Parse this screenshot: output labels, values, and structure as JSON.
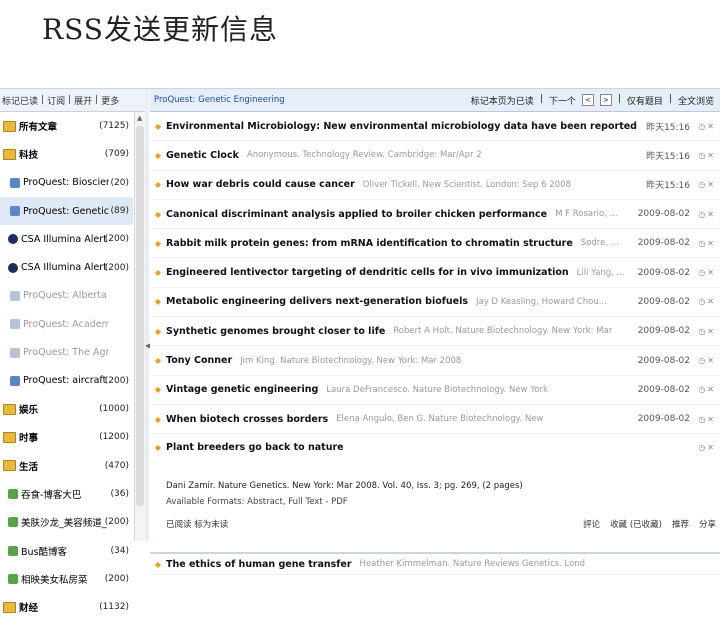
{
  "slide_title": "RSS发送更新信息",
  "left_toolbar": {
    "items": [
      "标记已读",
      "订阅",
      "展开",
      "更多"
    ]
  },
  "tree": [
    {
      "label": "所有文章",
      "count": "(7125)",
      "kind": "cat-root"
    },
    {
      "label": "科技",
      "count": "(709)",
      "kind": "cat"
    },
    {
      "label": "ProQuest: Bioscience...",
      "count": "(20)",
      "kind": "rss"
    },
    {
      "label": "ProQuest: Genetic En...",
      "count": "(89)",
      "kind": "rss",
      "selected": true
    },
    {
      "label": "CSA Illumina Alert: K...",
      "count": "(200)",
      "kind": "csa"
    },
    {
      "label": "CSA Illumina Alert: Ed...",
      "count": "(200)",
      "kind": "csa"
    },
    {
      "label": "ProQuest: Alberta Jou...",
      "count": "",
      "kind": "rss-gray"
    },
    {
      "label": "ProQuest: Academic ...",
      "count": "",
      "kind": "rss-gray"
    },
    {
      "label": "ProQuest: The Agricul...",
      "count": "",
      "kind": "rss-gray"
    },
    {
      "label": "ProQuest: aircraft",
      "count": "(200)",
      "kind": "rss"
    },
    {
      "label": "娱乐",
      "count": "(1000)",
      "kind": "cat"
    },
    {
      "label": "时事",
      "count": "(1200)",
      "kind": "cat"
    },
    {
      "label": "生活",
      "count": "(470)",
      "kind": "cat"
    },
    {
      "label": "吞食-博客大巴",
      "count": "(36)",
      "kind": "leaf"
    },
    {
      "label": "美肤沙龙_美容频道_...",
      "count": "(200)",
      "kind": "leaf"
    },
    {
      "label": "Bus酷博客",
      "count": "(34)",
      "kind": "leaf"
    },
    {
      "label": "相映美女私房菜",
      "count": "(200)",
      "kind": "leaf"
    },
    {
      "label": "财经",
      "count": "(1132)",
      "kind": "cat"
    }
  ],
  "right_toolbar": {
    "feed_name": "ProQuest: Genetic Engineering",
    "buttons": [
      "标记本页为已读",
      "下一个",
      "<",
      ">",
      "仅有题目",
      "全文浏览"
    ]
  },
  "articles": [
    {
      "title": "Environmental Microbiology: New environmental microbiology data have been reported",
      "meta": "",
      "date": "昨天15:16"
    },
    {
      "title": "Genetic Clock",
      "meta": "Anonymous. Technology Review. Cambridge: Mar/Apr 2",
      "date": "昨天15:16"
    },
    {
      "title": "How war debris could cause cancer",
      "meta": "Oliver Tickell. New Scientist. London: Sep 6 2008",
      "date": "昨天15:16"
    },
    {
      "title": "Canonical discriminant analysis applied to broiler chicken performance",
      "meta": "M F Rosario, ...",
      "date": "2009-08-02"
    },
    {
      "title": "Rabbit milk protein genes: from mRNA identification to chromatin structure",
      "meta": "Sodre, ...",
      "date": "2009-08-02"
    },
    {
      "title": "Engineered lentivector targeting of dendritic cells for in vivo immunization",
      "meta": "Lili Yang, ...",
      "date": "2009-08-02"
    },
    {
      "title": "Metabolic engineering delivers next-generation biofuels",
      "meta": "Jay D Keasling, Howard Chou...",
      "date": "2009-08-02"
    },
    {
      "title": "Synthetic genomes brought closer to life",
      "meta": "Robert A Holt. Nature Biotechnology. New York: Mar",
      "date": "2009-08-02"
    },
    {
      "title": "Tony Conner",
      "meta": "Jim King. Nature Biotechnology. New York: Mar 2008",
      "date": "2009-08-02"
    },
    {
      "title": "Vintage genetic engineering",
      "meta": "Laura DeFrancesco. Nature Biotechnology. New York",
      "date": "2009-08-02"
    },
    {
      "title": "When biotech crosses borders",
      "meta": "Elena Angulo, Ben G. Nature Biotechnology. New",
      "date": "2009-08-02"
    }
  ],
  "expanded_article": {
    "title": "Plant breeders go back to nature",
    "line1": "Dani Zamir. Nature Genetics. New York: Mar 2008. Vol. 40, Iss. 3; pg. 269, (2 pages)",
    "line2": "Available Formats: Abstract, Full Text - PDF",
    "actions_left": "已阅读  标为未读",
    "actions_right": [
      "評论",
      "收藏 (已收藏)",
      "推荐",
      "分享"
    ]
  },
  "last_article": {
    "title": "The ethics of human gene transfer",
    "meta": "Heather Kimmelman. Nature Reviews Genetics. Lond"
  }
}
